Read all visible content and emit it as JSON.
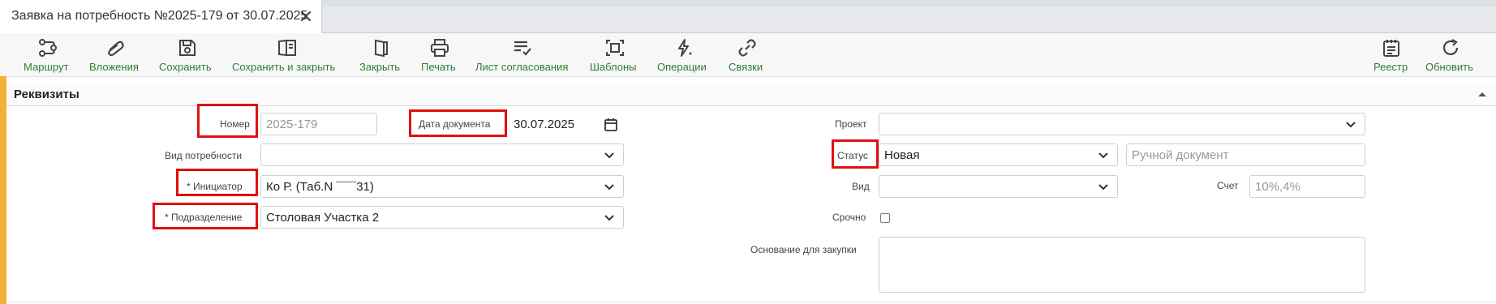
{
  "tab": {
    "title": "Заявка на потребность №2025-179 от 30.07.2025",
    "close_icon": "close-icon"
  },
  "toolbar": {
    "route": "Маршрут",
    "attachments": "Вложения",
    "save": "Сохранить",
    "save_close": "Сохранить и закрыть",
    "close": "Закрыть",
    "print": "Печать",
    "approval": "Лист согласования",
    "templates": "Шаблоны",
    "operations": "Операции",
    "links": "Связки",
    "registry": "Реестр",
    "refresh": "Обновить",
    "accent_color": "#2e7d32"
  },
  "panel": {
    "title": "Реквизиты"
  },
  "form": {
    "number_label": "Номер",
    "number_value": "2025-179",
    "doc_date_label": "Дата документа",
    "doc_date_value": "30.07.2025",
    "need_type_label": "Вид потребности",
    "need_type_value": "",
    "initiator_label": "* Инициатор",
    "initiator_value": "Ко                    Р. (Таб.N ¯¯¯31)",
    "department_label": "* Подразделение",
    "department_value": "Столовая Участка 2",
    "project_label": "Проект",
    "project_value": "",
    "status_label": "Статус",
    "status_value": "Новая",
    "manual_doc_placeholder": "Ручной документ",
    "kind_label": "Вид",
    "kind_value": "",
    "account_label": "Счет",
    "account_value": "10%,4%",
    "urgent_label": "Срочно",
    "urgent_checked": false,
    "purchase_basis_label": "Основание для закупки",
    "purchase_basis_value": ""
  },
  "colors": {
    "highlight": "#e01010",
    "accent_left": "#f2b134"
  }
}
